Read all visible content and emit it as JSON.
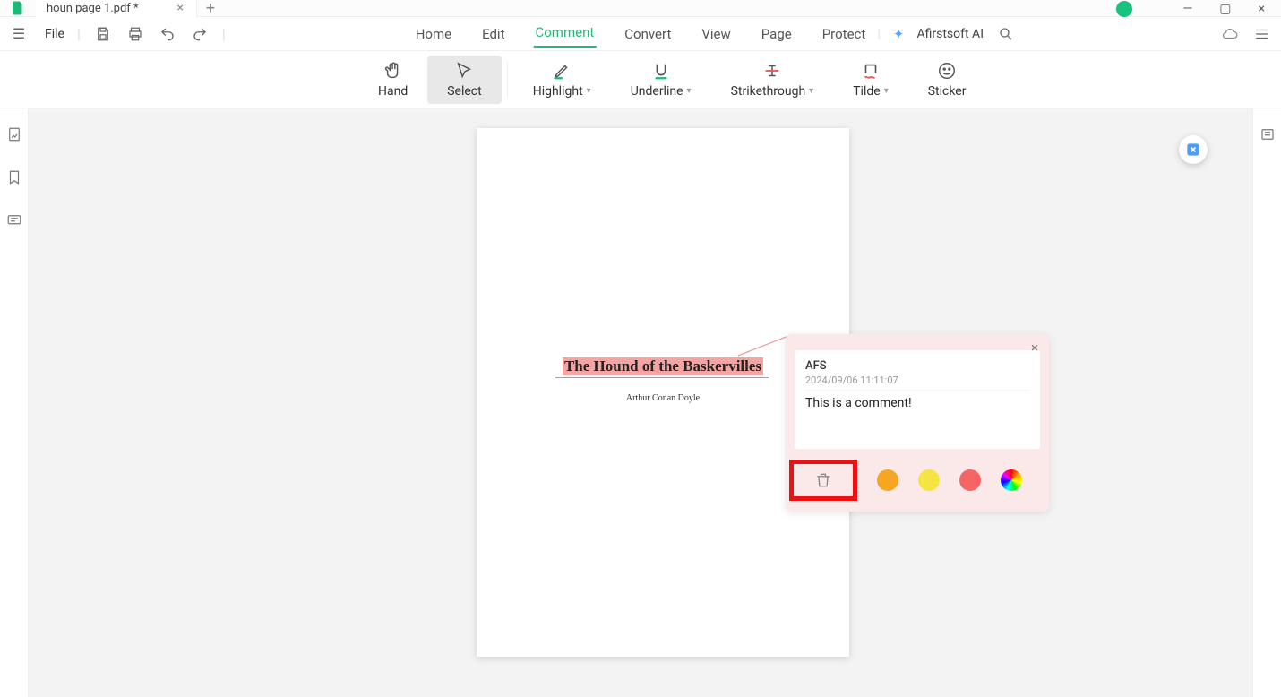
{
  "tab": {
    "name": "houn page 1.pdf *"
  },
  "menu": {
    "file": "File"
  },
  "topmenu": {
    "home": "Home",
    "edit": "Edit",
    "comment": "Comment",
    "convert": "Convert",
    "view": "View",
    "page": "Page",
    "protect": "Protect"
  },
  "ai": {
    "label": "Afirstsoft AI"
  },
  "tools": {
    "hand": "Hand",
    "select": "Select",
    "highlight": "Highlight",
    "underline": "Underline",
    "strikethrough": "Strikethrough",
    "tilde": "Tilde",
    "sticker": "Sticker"
  },
  "document": {
    "title": "The Hound of the Baskervilles",
    "author": "Arthur Conan Doyle"
  },
  "comment": {
    "user": "AFS",
    "timestamp": "2024/09/06 11:11:07",
    "text": "This is a comment!"
  },
  "colors": {
    "orange": "#f5a623",
    "yellow": "#f5e542",
    "red": "#f56565"
  }
}
